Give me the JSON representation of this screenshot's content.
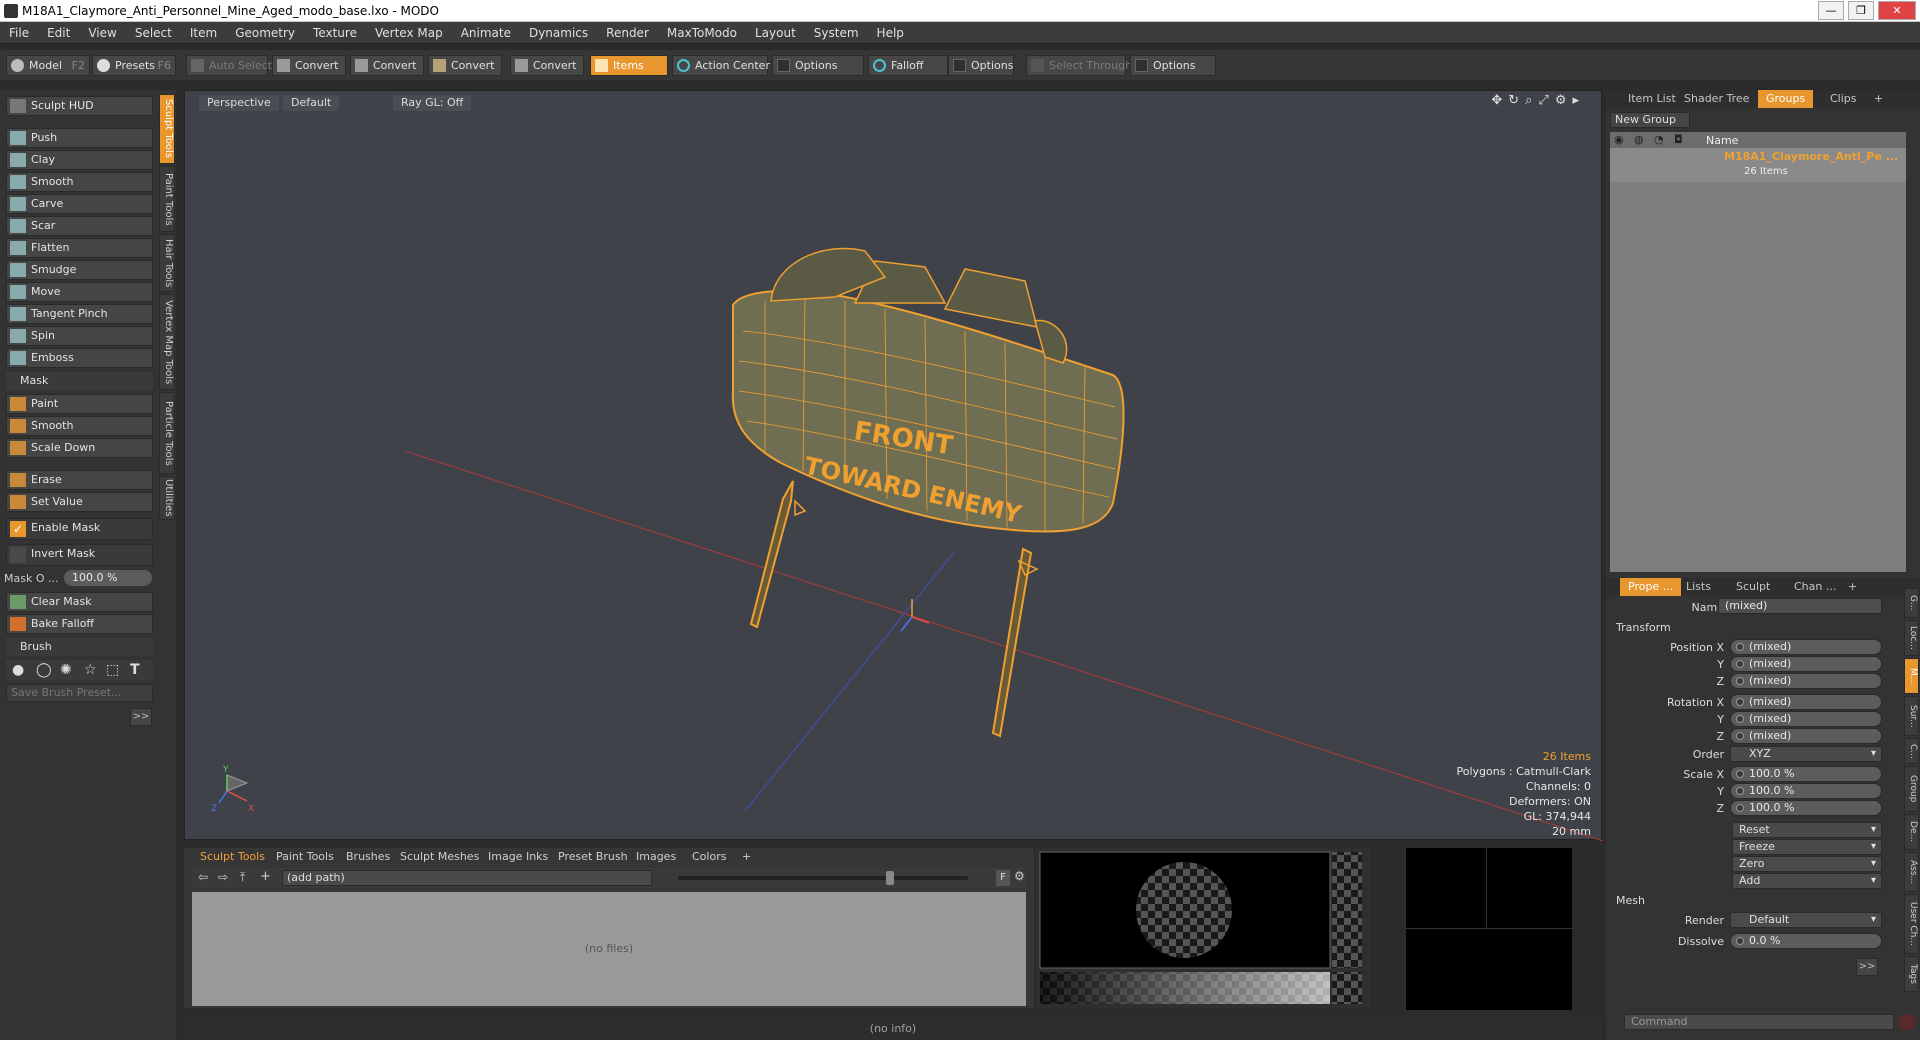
{
  "window": {
    "title": "M18A1_Claymore_Anti_Personnel_Mine_Aged_modo_base.lxo - MODO",
    "min": "—",
    "max": "❐",
    "close": "✕"
  },
  "menu": [
    "File",
    "Edit",
    "View",
    "Select",
    "Item",
    "Geometry",
    "Texture",
    "Vertex Map",
    "Animate",
    "Dynamics",
    "Render",
    "MaxToModo",
    "Layout",
    "System",
    "Help"
  ],
  "toolbar": {
    "model": "Model",
    "model_key": "F2",
    "presets": "Presets",
    "presets_key": "F6",
    "auto_select": "Auto Select",
    "convert1": "Convert",
    "convert2": "Convert",
    "convert3": "Convert",
    "convert4": "Convert",
    "items": "Items",
    "action_center": "Action Center",
    "options1": "Options",
    "falloff": "Falloff",
    "options2": "Options",
    "select_through": "Select Through",
    "options3": "Options"
  },
  "left": {
    "sculpt_hud": "Sculpt HUD",
    "tools": [
      "Push",
      "Clay",
      "Smooth",
      "Carve",
      "Scar",
      "Flatten",
      "Smudge",
      "Move",
      "Tangent Pinch",
      "Spin",
      "Emboss"
    ],
    "mask_head": "Mask",
    "mask_tools": [
      "Paint",
      "Smooth",
      "Scale Down"
    ],
    "erase": "Erase",
    "set_value": "Set Value",
    "enable_mask": "Enable Mask",
    "invert_mask": "Invert Mask",
    "mask_opacity_label": "Mask O ...",
    "mask_opacity_value": "100.0 %",
    "clear_mask": "Clear Mask",
    "bake_falloff": "Bake Falloff",
    "brush_head": "Brush",
    "save_brush": "Save Brush Preset...",
    "more": ">>",
    "side_tabs": [
      "Sculpt Tools",
      "Paint Tools",
      "Hair Tools",
      "Vertex Map Tools",
      "Particle Tools",
      "Utilities"
    ]
  },
  "viewport": {
    "tabs": [
      "Perspective",
      "Default",
      "Ray GL: Off"
    ],
    "text_front": "FRONT",
    "text_toward": "TOWARD ENEMY",
    "info": {
      "items": "26 Items",
      "polygons": "Polygons : Catmull-Clark",
      "channels": "Channels: 0",
      "deformers": "Deformers: ON",
      "gl": "GL: 374,944",
      "size": "20 mm"
    },
    "axis_x": "X",
    "axis_y": "Y",
    "axis_z": "Z"
  },
  "bottom": {
    "tabs": [
      "Sculpt Tools",
      "Paint Tools",
      "Brushes",
      "Sculpt Meshes",
      "Image Inks",
      "Preset Brush",
      "Images",
      "Colors",
      "+"
    ],
    "path": "(add path)",
    "no_files": "(no files)",
    "f_btn": "F"
  },
  "status": "(no info)",
  "right": {
    "tabs": [
      "Item List",
      "Shader Tree",
      "Groups",
      "Clips",
      "+"
    ],
    "new_group": "New Group",
    "name_col": "Name",
    "group_name": "M18A1_Claymore_Anti_Pe ...",
    "group_count": "26 Items",
    "prop_tabs": [
      "Prope ...",
      "Lists",
      "Sculpt",
      "Chan ...",
      "+"
    ],
    "name_label": "Name",
    "name_value": "(mixed)",
    "transform_head": "Transform",
    "position_x": "Position X",
    "y": "Y",
    "z": "Z",
    "rotation_x": "Rotation X",
    "mixed": "(mixed)",
    "order_label": "Order",
    "order_value": "XYZ",
    "scale_x": "Scale X",
    "scale_value": "100.0 %",
    "reset": "Reset",
    "freeze": "Freeze",
    "zero": "Zero",
    "add": "Add",
    "mesh_head": "Mesh",
    "render_label": "Render",
    "render_value": "Default",
    "dissolve_label": "Dissolve",
    "dissolve_value": "0.0 %",
    "more": ">>",
    "command": "Command",
    "side_tabs": [
      "G...",
      "Loc...",
      "M...",
      "Sur...",
      "C...",
      "Group",
      "De...",
      "Ass...",
      "User Ch...",
      "Tags"
    ]
  },
  "colors": {
    "accent": "#e8962e",
    "wire": "#f0a030",
    "mesh": "#6f6e52"
  }
}
